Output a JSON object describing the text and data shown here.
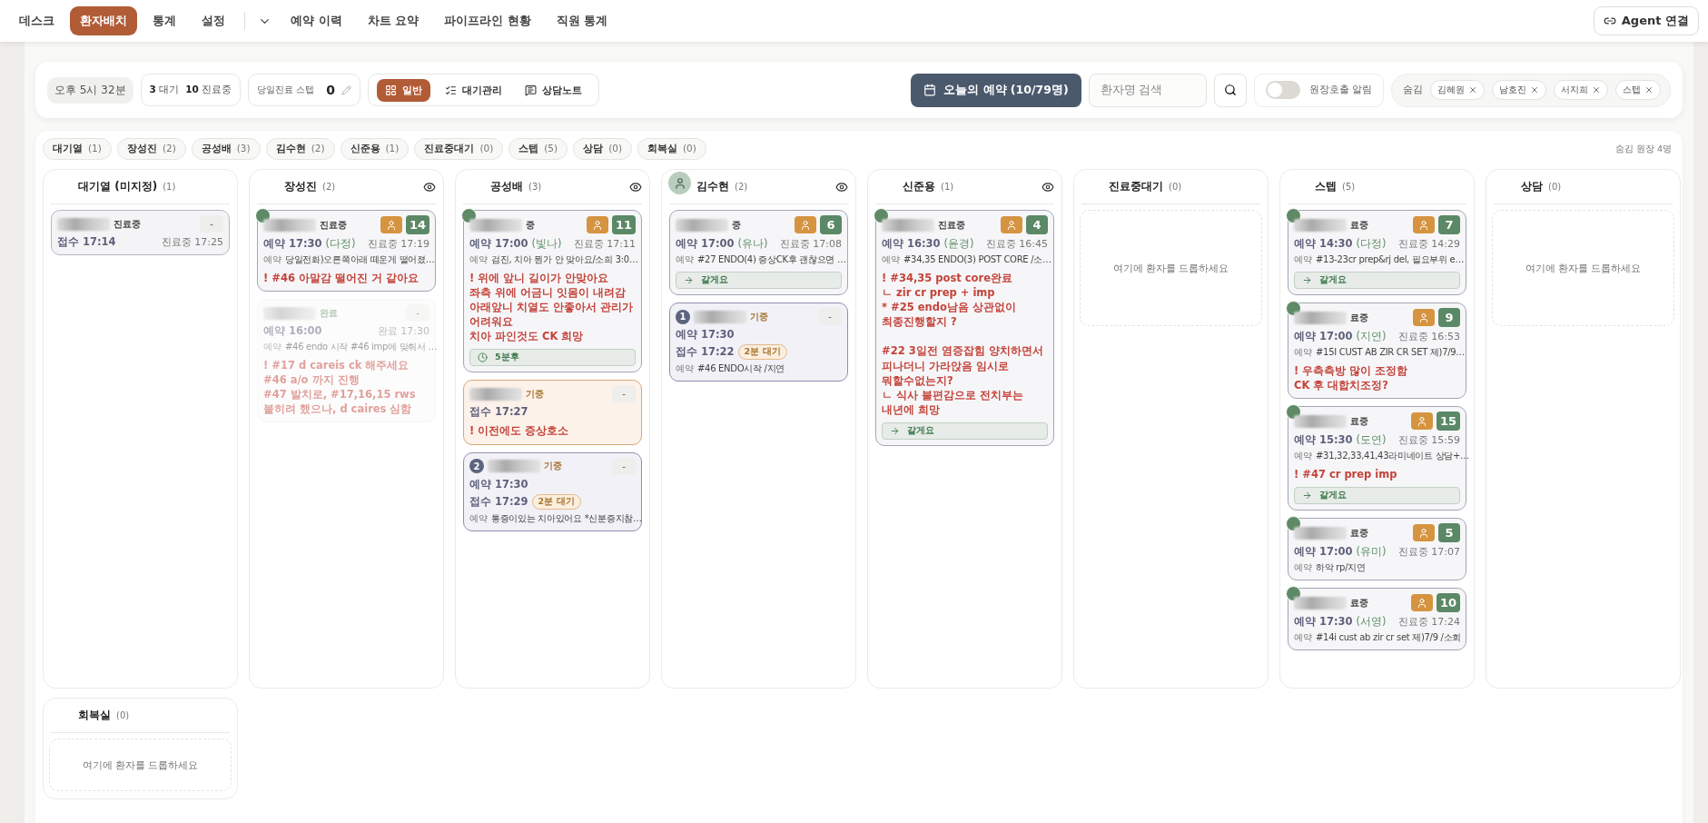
{
  "nav": {
    "tabs": [
      {
        "label": "데스크",
        "selected": false
      },
      {
        "label": "환자배치",
        "selected": true
      },
      {
        "label": "통계",
        "selected": false
      },
      {
        "label": "설정",
        "selected": false
      }
    ],
    "links": [
      "예약 이력",
      "차트 요약",
      "파이프라인 현황",
      "직원 통계"
    ],
    "agent_button": "Agent 연결"
  },
  "toolbar": {
    "clock": "오후 5시 32분",
    "counts": [
      {
        "number": "3",
        "label": "대기"
      },
      {
        "number": "10",
        "label": "진료중"
      }
    ],
    "staff": {
      "label": "당일진료 스텝",
      "value": "0"
    },
    "views": [
      {
        "label": "일반",
        "selected": true
      },
      {
        "label": "대기관리",
        "selected": false
      },
      {
        "label": "상담노트",
        "selected": false
      }
    ],
    "reservations_button": "오늘의 예약 (10/79명)",
    "search": {
      "placeholder": "환자명 검색"
    },
    "call_alert": {
      "label": "원장호출 알림",
      "on": false
    },
    "hidden": {
      "label": "숨김",
      "chips": [
        "김혜원",
        "남호진",
        "서지희",
        "스텝"
      ]
    }
  },
  "filters": [
    {
      "name": "대기열",
      "count": "(1)"
    },
    {
      "name": "장성진",
      "count": "(2)"
    },
    {
      "name": "공성배",
      "count": "(3)"
    },
    {
      "name": "김수현",
      "count": "(2)"
    },
    {
      "name": "신준용",
      "count": "(1)"
    },
    {
      "name": "진료중대기",
      "count": "(0)"
    },
    {
      "name": "스텝",
      "count": "(5)"
    },
    {
      "name": "상담",
      "count": "(0)"
    },
    {
      "name": "회복실",
      "count": "(0)"
    }
  ],
  "hidden_note": "숨김 원장 4명",
  "columns": [
    {
      "title": "대기열 (미지정)",
      "count": "(1)",
      "cards": [
        {
          "kind": "queue",
          "status": "진료중",
          "menu": "-",
          "main": "접수 17:14",
          "side": "진료중 17:25"
        }
      ]
    },
    {
      "title": "장성진",
      "count": "(2)",
      "watch": true,
      "cards": [
        {
          "kind": "active",
          "avatar": true,
          "status": "진료중",
          "badge": "14",
          "main": "예약 17:30",
          "who": "(다정)",
          "side": "진료중 17:19",
          "memo_label": "예약",
          "memo": "당일전화)오른쪽아래 떼운게 떨어졌…",
          "note": "! #46 아말감 떨어진 거 같아요"
        },
        {
          "kind": "done",
          "status": "완료",
          "menu": "-",
          "main": "예약 16:00",
          "side": "완료 17:30",
          "memo_label": "예약",
          "memo": "#46 endo 시작 #46 imp에 맞춰서 …",
          "note": "! #17 d careis ck 해주세요\n#46 a/o 까지 진행\n#47 발치로, #17,16,15 rws\n붙히려 했으나, d caires 심함"
        }
      ]
    },
    {
      "title": "공성배",
      "count": "(3)",
      "watch": true,
      "cards": [
        {
          "kind": "active",
          "avatar": true,
          "status": "중",
          "badge": "11",
          "main": "예약 17:00",
          "who": "(빛나)",
          "side": "진료중 17:11",
          "memo_label": "예약",
          "memo": "검진, 치아 뭔가 안 맞아요/소희 3:0…",
          "note": "! 위에 앞니 길이가 안맞아요\n좌측 위에 어금니 잇몸이 내려감\n아래앞니 치열도 안좋아서 관리가\n어려워요\n치아 파인것도 CK 희망",
          "timer": "5분후"
        },
        {
          "kind": "alert",
          "status": "기중",
          "menu": "-",
          "main": "접수 17:27",
          "note": "! 이전에도 증상호소"
        },
        {
          "kind": "queued",
          "order": "2",
          "status": "기중",
          "menu": "-",
          "main": "예약 17:30",
          "receipt": "접수 17:29",
          "wait": "2분 대기",
          "memo_label": "예약",
          "memo": "통증이있는 치아있어요 *신분증지참…"
        }
      ]
    },
    {
      "title": "김수현",
      "count": "(2)",
      "watch": true,
      "avatar": true,
      "cards": [
        {
          "kind": "active",
          "status": "중",
          "badge": "6",
          "main": "예약 17:00",
          "who": "(유나)",
          "side": "진료중 17:08",
          "memo_label": "예약",
          "memo": "#27 ENDO(4) 증상CK후 괜찮으면 …",
          "action": "갈게요"
        },
        {
          "kind": "queued",
          "order": "1",
          "status": "기중",
          "menu": "-",
          "main": "예약 17:30",
          "receipt": "접수 17:22",
          "wait": "2분 대기",
          "memo_label": "예약",
          "memo": "#46 ENDO시작 /지연"
        }
      ]
    },
    {
      "title": "신준용",
      "count": "(1)",
      "watch": true,
      "cards": [
        {
          "kind": "active",
          "avatar": true,
          "status": "진료중",
          "badge": "4",
          "main": "예약 16:30",
          "who": "(윤경)",
          "side": "진료중 16:45",
          "memo_label": "예약",
          "memo": "#34,35 ENDO(3) POST CORE /소…",
          "note": "! #34,35 post core완료\nㄴ zir cr prep + imp\n* #25 endo남음 상관없이\n최종진행할지 ?\n\n#22 3일전 염증잡힘 양치하면서\n피나더니 가라앉음 임시로\n뭐할수없는지?\nㄴ 식사 불편감으로 전치부는\n내년에 희망",
          "action": "갈게요"
        }
      ]
    },
    {
      "title": "진료중대기",
      "count": "(0)",
      "empty": "여기에 환자를 드롭하세요"
    },
    {
      "title": "스텝",
      "count": "(5)",
      "cards": [
        {
          "kind": "active",
          "avatar": true,
          "status": "료중",
          "badge": "7",
          "main": "예약 14:30",
          "who": "(다정)",
          "side": "진료중 14:29",
          "memo_label": "예약",
          "memo": "#13-23cr prep&rj del, 필요부위 e…",
          "action": "갈게요"
        },
        {
          "kind": "active",
          "avatar": true,
          "status": "료중",
          "badge": "9",
          "main": "예약 17:00",
          "who": "(지연)",
          "side": "진료중 16:53",
          "memo_label": "예약",
          "memo": "#15I CUST AB ZIR CR SET 제)7/9…",
          "note": "! 우측측방 많이 조정함\nCK 후 대합치조정?"
        },
        {
          "kind": "active",
          "avatar": true,
          "status": "료중",
          "badge": "15",
          "main": "예약 15:30",
          "who": "(도연)",
          "side": "진료중 15:59",
          "memo_label": "예약",
          "memo": "#31,32,33,41,43라미네이트 상담+…",
          "note": "! #47 cr prep imp",
          "action": "갈게요"
        },
        {
          "kind": "active",
          "avatar": true,
          "status": "료중",
          "badge": "5",
          "main": "예약 17:00",
          "who": "(유미)",
          "side": "진료중 17:07",
          "memo_label": "예약",
          "memo": "하악 rp/지연"
        },
        {
          "kind": "active",
          "avatar": true,
          "status": "료중",
          "badge": "10",
          "main": "예약 17:30",
          "who": "(서영)",
          "side": "진료중 17:24",
          "memo_label": "예약",
          "memo": "#14i cust ab zir cr set 제)7/9 /소회"
        }
      ]
    },
    {
      "title": "상담",
      "count": "(0)",
      "empty": "여기에 환자를 드롭하세요"
    },
    {
      "title": "회복실",
      "count": "(0)",
      "empty": "여기에 환자를 드롭하세요"
    }
  ]
}
